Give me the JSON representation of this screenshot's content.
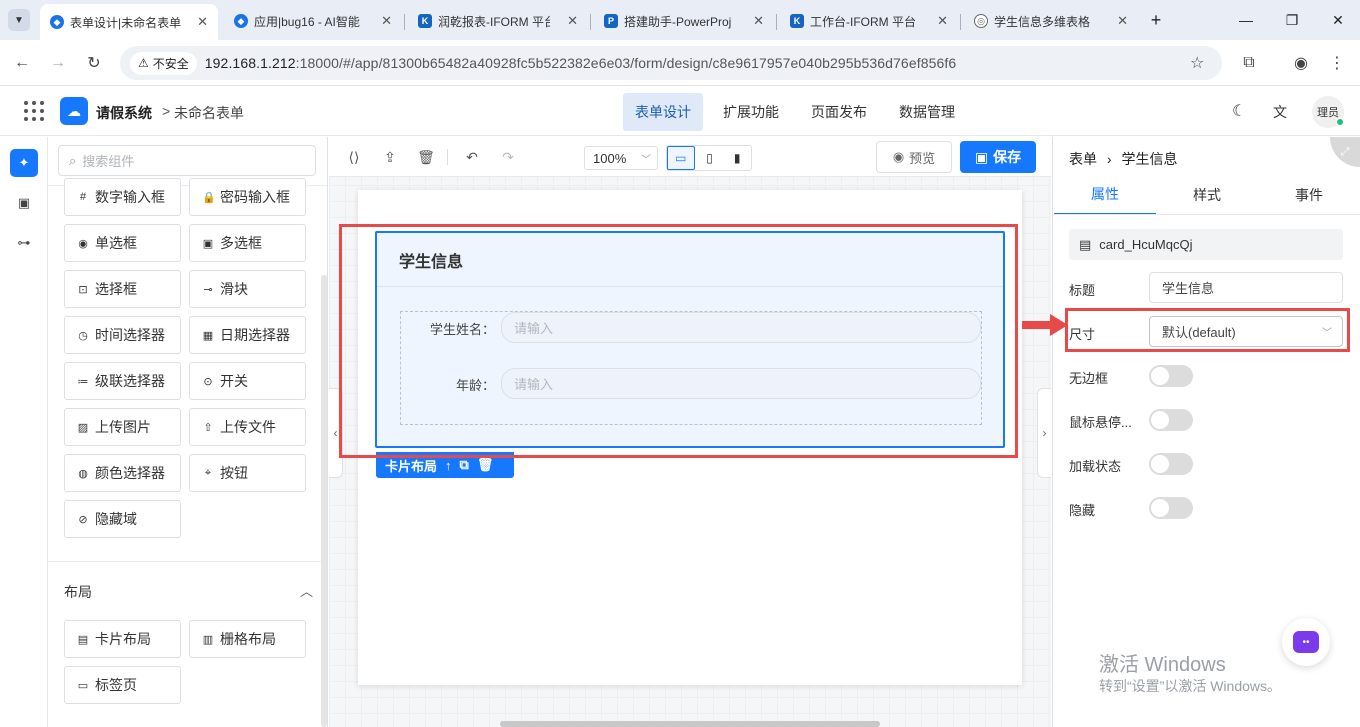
{
  "browser": {
    "tabs": [
      {
        "title": "表单设计|未命名表单",
        "active": true,
        "favicon_color": "#1a73e8"
      },
      {
        "title": "应用|bug16 - AI智能",
        "active": false,
        "favicon_color": "#1a73e8"
      },
      {
        "title": "润乾报表-IFORM 平台",
        "active": false,
        "favicon_color": "#1565c0"
      },
      {
        "title": "搭建助手-PowerProj",
        "active": false,
        "favicon_color": "#1565c0"
      },
      {
        "title": "工作台-IFORM 平台",
        "active": false,
        "favicon_color": "#1565c0"
      },
      {
        "title": "学生信息多维表格",
        "active": false,
        "favicon_color": "#666666"
      }
    ],
    "insecure_label": "不安全",
    "url_host": "192.168.1.212",
    "url_rest": ":18000/#/app/81300b65482a40928fc5b522382e6e03/form/design/c8e9617957e040b295b536d76ef856f6"
  },
  "header": {
    "app_name": "请假系统",
    "breadcrumb_sep": ">",
    "form_name": "未命名表单",
    "menu": [
      "表单设计",
      "扩展功能",
      "页面发布",
      "数据管理"
    ],
    "avatar": "理员"
  },
  "components": {
    "search_placeholder": "搜索组件",
    "items": [
      {
        "label": "数字输入框",
        "icon": "#"
      },
      {
        "label": "密码输入框",
        "icon": "🔒"
      },
      {
        "label": "单选框",
        "icon": "◉"
      },
      {
        "label": "多选框",
        "icon": "▣"
      },
      {
        "label": "选择框",
        "icon": "⊡"
      },
      {
        "label": "滑块",
        "icon": "⊸"
      },
      {
        "label": "时间选择器",
        "icon": "◷"
      },
      {
        "label": "日期选择器",
        "icon": "▦"
      },
      {
        "label": "级联选择器",
        "icon": "≔"
      },
      {
        "label": "开关",
        "icon": "⊙"
      },
      {
        "label": "上传图片",
        "icon": "▨"
      },
      {
        "label": "上传文件",
        "icon": "⇧"
      },
      {
        "label": "颜色选择器",
        "icon": "◍"
      },
      {
        "label": "按钮",
        "icon": "⌖"
      },
      {
        "label": "隐藏域",
        "icon": "⊘"
      }
    ],
    "layout_section_title": "布局",
    "layout_items": [
      {
        "label": "卡片布局",
        "icon": "▤"
      },
      {
        "label": "栅格布局",
        "icon": "▥"
      },
      {
        "label": "标签页",
        "icon": "▭"
      }
    ]
  },
  "toolbar": {
    "zoom": "100%",
    "preview_label": "预览",
    "save_label": "保存"
  },
  "canvas": {
    "card_title": "学生信息",
    "fields": [
      {
        "label": "学生姓名：",
        "placeholder": "请输入"
      },
      {
        "label": "年龄：",
        "placeholder": "请输入"
      }
    ],
    "card_tag_label": "卡片布局"
  },
  "props": {
    "breadcrumb": [
      "表单",
      "学生信息"
    ],
    "tabs": [
      "属性",
      "样式",
      "事件"
    ],
    "component_id": "card_HcuMqcQj",
    "title_label": "标题",
    "title_value": "学生信息",
    "size_label": "尺寸",
    "size_value": "默认(default)",
    "toggles": [
      {
        "label": "无边框",
        "on": false
      },
      {
        "label": "鼠标悬停...",
        "on": false
      },
      {
        "label": "加载状态",
        "on": false
      },
      {
        "label": "隐藏",
        "on": false
      }
    ]
  },
  "watermark": {
    "line1": "激活 Windows",
    "line2": "转到“设置”以激活 Windows。"
  },
  "colors": {
    "accent": "#1677ff",
    "highlight_red": "#e84a4a"
  }
}
